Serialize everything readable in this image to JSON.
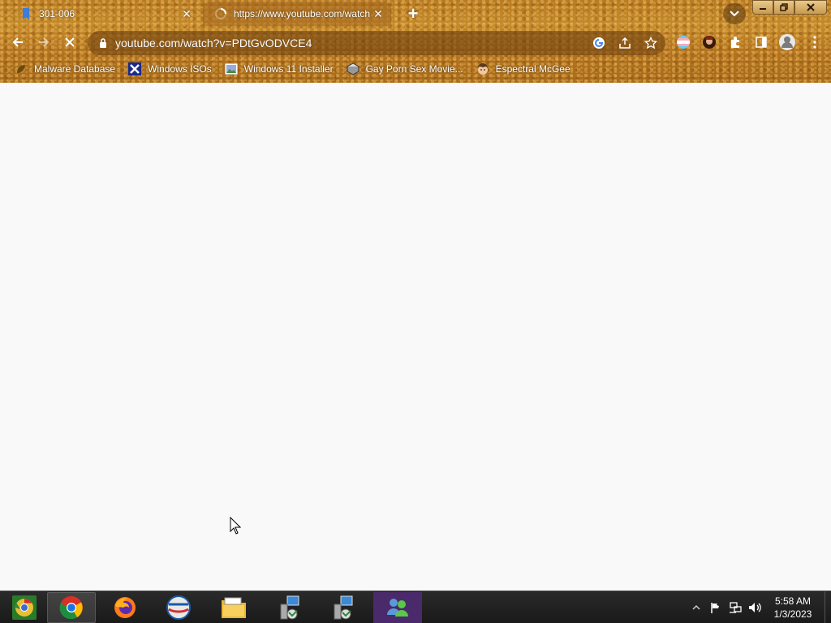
{
  "browser": {
    "tabs": [
      {
        "title": "301-006",
        "favicon": "bookmark-blue-icon"
      },
      {
        "title": "https://www.youtube.com/watch",
        "favicon": "loading-spinner-icon"
      }
    ],
    "new_tab_label": "+",
    "close_glyph": "✕"
  },
  "toolbar": {
    "url": "youtube.com/watch?v=PDtGvODVCE4"
  },
  "bookmarks": [
    {
      "label": "Malware Database",
      "icon": "leaf-icon"
    },
    {
      "label": "Windows ISOs",
      "icon": "x-logo-icon"
    },
    {
      "label": "Windows 11 Installer",
      "icon": "image-icon"
    },
    {
      "label": "Gay Porn Sex Movie...",
      "icon": "disk-icon"
    },
    {
      "label": "Espectral McGee",
      "icon": "face-icon"
    }
  ],
  "taskbar": {
    "apps": [
      "chrome-canary-icon",
      "chrome-icon",
      "firefox-icon",
      "opera-icon",
      "file-explorer-icon",
      "network-setup-icon",
      "network-setup-icon",
      "users-icon"
    ],
    "clock_time": "5:58 AM",
    "clock_date": "1/3/2023"
  },
  "colors": {
    "frame": "#b87a22",
    "taskbar": "#1f1f1f",
    "page": "#f9f9f9"
  }
}
